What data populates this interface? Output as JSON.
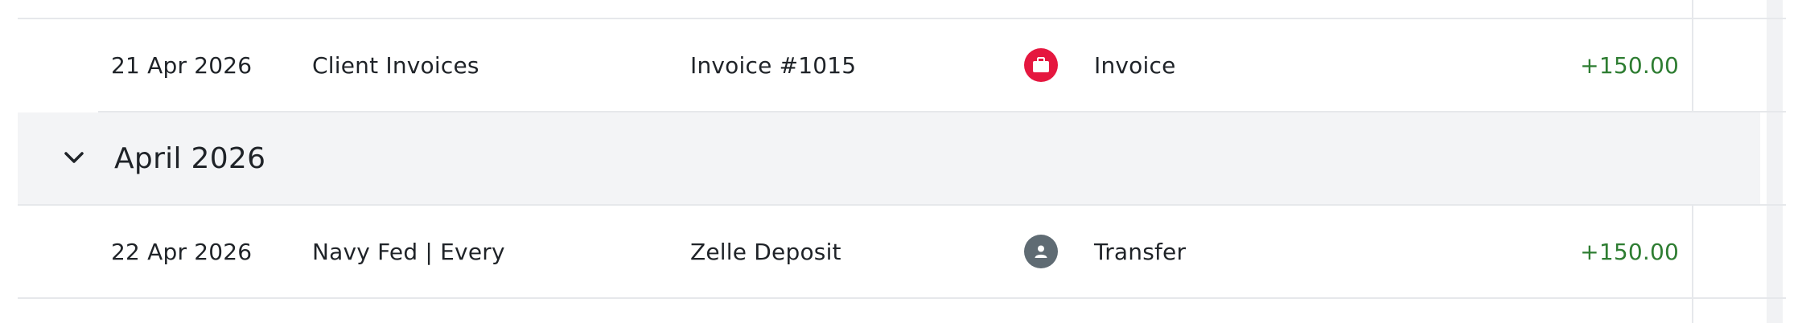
{
  "rows": [
    {
      "date": "21 Apr 2026",
      "account": "Client Invoices",
      "description": "Invoice #1015",
      "category_icon": "briefcase-icon",
      "category_icon_color": "#e5173f",
      "category": "Invoice",
      "amount": "+150.00"
    },
    {
      "date": "22 Apr 2026",
      "account": "Navy Fed | Every…",
      "description": "Zelle Deposit",
      "category_icon": "person-icon",
      "category_icon_color": "#5f6b73",
      "category": "Transfer",
      "amount": "+150.00"
    }
  ],
  "group": {
    "title": "April 2026",
    "toggle_icon": "chevron-down-icon"
  },
  "colors": {
    "positive_amount": "#2e7d32",
    "group_header_bg": "#f3f4f6",
    "divider": "#e6e8eb"
  }
}
